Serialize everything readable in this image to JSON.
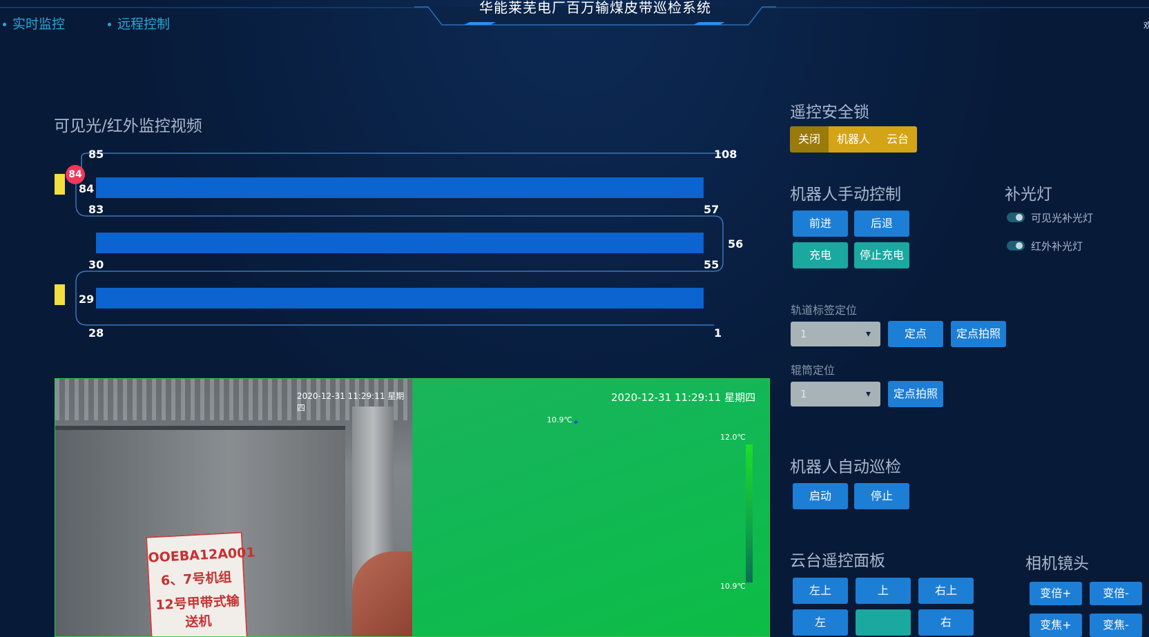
{
  "header": {
    "title": "华能莱芜电厂百万输煤皮带巡检系统",
    "nav": [
      "实时监控",
      "远程控制"
    ],
    "edge_char": "欢"
  },
  "belt": {
    "section_title": "可见光/红外监控视频",
    "labels": {
      "top_left": "85",
      "top_right": "108",
      "row1_left": "84",
      "row1_bottom_left": "83",
      "row1_bottom_right": "57",
      "mid_right": "56",
      "row2_bottom_left": "30",
      "row2_bottom_right": "55",
      "row3_left": "29",
      "bottom_left": "28",
      "bottom_right": "1"
    },
    "marker": "84"
  },
  "video": {
    "visible_stamp": "2020-12-31 11:29:11 星期四",
    "ir_stamp": "2020-12-31 11:29:11 星期四",
    "ir_point": "10.9℃",
    "ir_max": "12.0℃",
    "ir_min": "10.9℃",
    "sign_lines": [
      "OOEBA12A001",
      "6、7号机组",
      "12号甲带式输送机"
    ]
  },
  "controls": {
    "lock": {
      "title": "遥控安全锁",
      "options": [
        "关闭",
        "机器人",
        "云台"
      ]
    },
    "manual": {
      "title": "机器人手动控制",
      "forward": "前进",
      "back": "后退",
      "charge": "充电",
      "stop_charge": "停止充电"
    },
    "light": {
      "title": "补光灯",
      "visible": "可见光补光灯",
      "infrared": "红外补光灯"
    },
    "track": {
      "label": "轨道标签定位",
      "value": "1",
      "fix": "定点",
      "fix_photo": "定点拍照"
    },
    "roller": {
      "label": "辊筒定位",
      "value": "1",
      "fix_photo": "定点拍照"
    },
    "auto": {
      "title": "机器人自动巡检",
      "start": "启动",
      "stop": "停止"
    },
    "ptz": {
      "title": "云台遥控面板",
      "up_left": "左上",
      "up": "上",
      "up_right": "右上",
      "left": "左",
      "right": "右"
    },
    "lens": {
      "title": "相机镜头",
      "zoom_in": "变倍+",
      "zoom_out": "变倍-",
      "focus_in": "变焦+",
      "focus_out": "变焦-"
    }
  }
}
